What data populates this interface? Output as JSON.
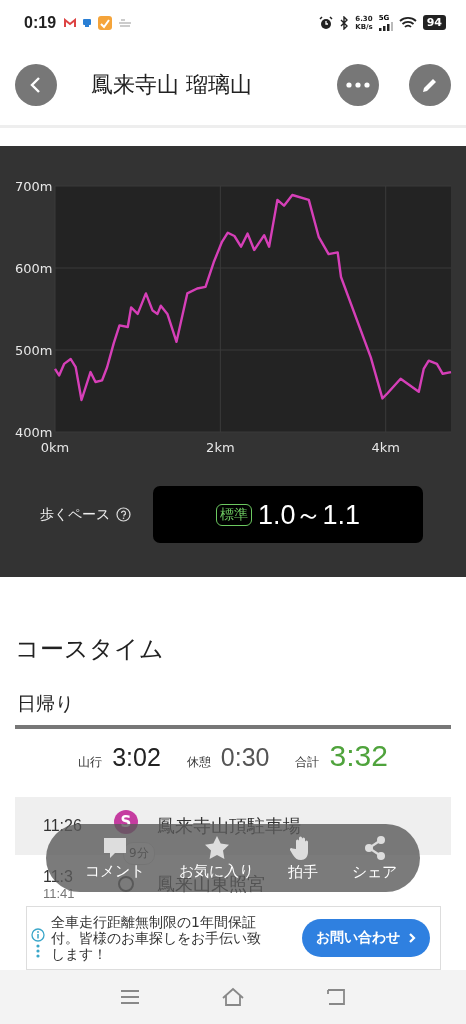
{
  "status_bar": {
    "time": "0:19",
    "net_speed": "6.30",
    "net_unit": "KB/s",
    "network": "5G",
    "battery": "94"
  },
  "header": {
    "title": "鳳来寺山 瑠璃山"
  },
  "elevation": {
    "chart_data": {
      "type": "line",
      "grid": true,
      "xlim": [
        0,
        4.79
      ],
      "ylim": [
        400,
        700
      ],
      "xticks": [
        {
          "value": 0,
          "label": "0km"
        },
        {
          "value": 2,
          "label": "2km"
        },
        {
          "value": 4,
          "label": "4km"
        }
      ],
      "yticks": [
        {
          "value": 400,
          "label": "400m"
        },
        {
          "value": 500,
          "label": "500m"
        },
        {
          "value": 600,
          "label": "600m"
        },
        {
          "value": 700,
          "label": "700m"
        }
      ],
      "series": [
        {
          "color": "#d63fb8",
          "x": [
            0,
            0.05,
            0.11,
            0.19,
            0.25,
            0.32,
            0.43,
            0.49,
            0.57,
            0.63,
            0.71,
            0.78,
            0.88,
            0.92,
            1.0,
            1.1,
            1.18,
            1.24,
            1.28,
            1.36,
            1.47,
            1.6,
            1.72,
            1.82,
            1.92,
            2.02,
            2.09,
            2.17,
            2.25,
            2.33,
            2.41,
            2.53,
            2.59,
            2.69,
            2.77,
            2.87,
            3.07,
            3.19,
            3.31,
            3.42,
            3.46,
            3.82,
            3.96,
            4.02,
            4.18,
            4.4,
            4.46,
            4.52,
            4.62,
            4.69,
            4.79
          ],
          "values": [
            477,
            469,
            483,
            489,
            479,
            439,
            473,
            461,
            463,
            479,
            508,
            530,
            528,
            552,
            544,
            569,
            548,
            544,
            554,
            544,
            510,
            569,
            575,
            577,
            607,
            632,
            643,
            639,
            626,
            642,
            622,
            640,
            626,
            683,
            676,
            689,
            683,
            638,
            617,
            619,
            589,
            491,
            441,
            447,
            465,
            449,
            477,
            487,
            483,
            471,
            473
          ]
        }
      ]
    },
    "pace_label": "歩くペース",
    "pace_badge": "標準",
    "pace_value": "1.0～1.1"
  },
  "course_time": {
    "heading": "コースタイム",
    "tab": "日帰り",
    "totals": [
      {
        "kind": "plain",
        "label": "山行",
        "value": "3:02"
      },
      {
        "kind": "muted",
        "label": "休憩",
        "value": "0:30"
      },
      {
        "kind": "total",
        "label": "合計",
        "value": "3:32"
      }
    ],
    "stops": [
      {
        "kind": "start",
        "times": [
          "11:26"
        ],
        "marker": "S",
        "name": "鳳来寺山頂駐車場",
        "highlighted": true
      },
      {
        "kind": "waypoint",
        "times": [
          "11:3",
          "11:41"
        ],
        "name": "鳳来山東照宮",
        "highlighted": false
      }
    ],
    "legs": [
      "9分"
    ]
  },
  "actions": [
    "コメント",
    "お気に入り",
    "拍手",
    "シェア"
  ],
  "ad": {
    "text": "全車走行距離無制限の1年間保証付。皆様のお車探しをお手伝い致します！",
    "button": "お問い合わせ"
  }
}
